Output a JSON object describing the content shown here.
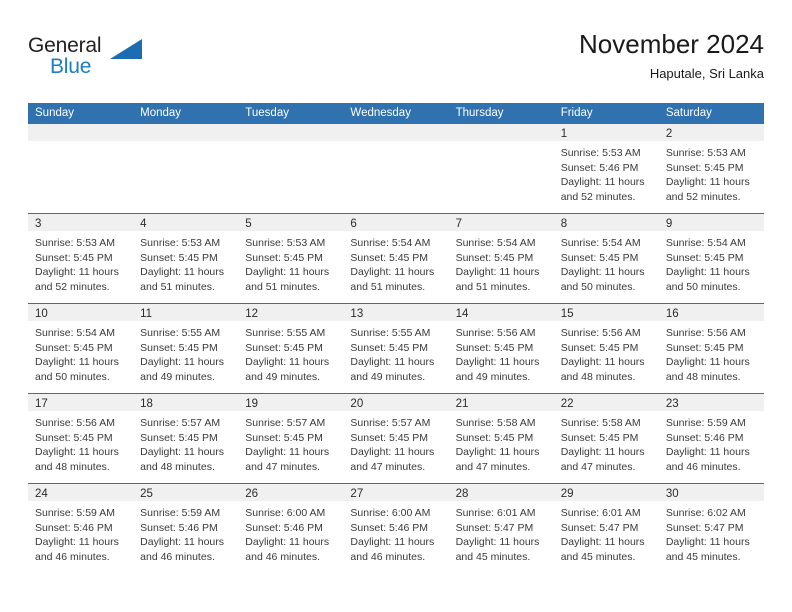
{
  "brand": {
    "word_one": "General",
    "word_two": "Blue",
    "logo_icon": "triangle-mark"
  },
  "header": {
    "month_title": "November 2024",
    "location": "Haputale, Sri Lanka"
  },
  "colors": {
    "header_blue": "#3071b0",
    "row_rule_blue": "#3071b0",
    "daynum_band": "#f0f0f0",
    "brand_blue": "#1b7fc4",
    "text": "#3a3a3a"
  },
  "calendar": {
    "weekday_headers": [
      "Sunday",
      "Monday",
      "Tuesday",
      "Wednesday",
      "Thursday",
      "Friday",
      "Saturday"
    ],
    "weeks": [
      [
        {
          "day": "",
          "lines": []
        },
        {
          "day": "",
          "lines": []
        },
        {
          "day": "",
          "lines": []
        },
        {
          "day": "",
          "lines": []
        },
        {
          "day": "",
          "lines": []
        },
        {
          "day": "1",
          "lines": [
            "Sunrise: 5:53 AM",
            "Sunset: 5:46 PM",
            "Daylight: 11 hours",
            "and 52 minutes."
          ]
        },
        {
          "day": "2",
          "lines": [
            "Sunrise: 5:53 AM",
            "Sunset: 5:45 PM",
            "Daylight: 11 hours",
            "and 52 minutes."
          ]
        }
      ],
      [
        {
          "day": "3",
          "lines": [
            "Sunrise: 5:53 AM",
            "Sunset: 5:45 PM",
            "Daylight: 11 hours",
            "and 52 minutes."
          ]
        },
        {
          "day": "4",
          "lines": [
            "Sunrise: 5:53 AM",
            "Sunset: 5:45 PM",
            "Daylight: 11 hours",
            "and 51 minutes."
          ]
        },
        {
          "day": "5",
          "lines": [
            "Sunrise: 5:53 AM",
            "Sunset: 5:45 PM",
            "Daylight: 11 hours",
            "and 51 minutes."
          ]
        },
        {
          "day": "6",
          "lines": [
            "Sunrise: 5:54 AM",
            "Sunset: 5:45 PM",
            "Daylight: 11 hours",
            "and 51 minutes."
          ]
        },
        {
          "day": "7",
          "lines": [
            "Sunrise: 5:54 AM",
            "Sunset: 5:45 PM",
            "Daylight: 11 hours",
            "and 51 minutes."
          ]
        },
        {
          "day": "8",
          "lines": [
            "Sunrise: 5:54 AM",
            "Sunset: 5:45 PM",
            "Daylight: 11 hours",
            "and 50 minutes."
          ]
        },
        {
          "day": "9",
          "lines": [
            "Sunrise: 5:54 AM",
            "Sunset: 5:45 PM",
            "Daylight: 11 hours",
            "and 50 minutes."
          ]
        }
      ],
      [
        {
          "day": "10",
          "lines": [
            "Sunrise: 5:54 AM",
            "Sunset: 5:45 PM",
            "Daylight: 11 hours",
            "and 50 minutes."
          ]
        },
        {
          "day": "11",
          "lines": [
            "Sunrise: 5:55 AM",
            "Sunset: 5:45 PM",
            "Daylight: 11 hours",
            "and 49 minutes."
          ]
        },
        {
          "day": "12",
          "lines": [
            "Sunrise: 5:55 AM",
            "Sunset: 5:45 PM",
            "Daylight: 11 hours",
            "and 49 minutes."
          ]
        },
        {
          "day": "13",
          "lines": [
            "Sunrise: 5:55 AM",
            "Sunset: 5:45 PM",
            "Daylight: 11 hours",
            "and 49 minutes."
          ]
        },
        {
          "day": "14",
          "lines": [
            "Sunrise: 5:56 AM",
            "Sunset: 5:45 PM",
            "Daylight: 11 hours",
            "and 49 minutes."
          ]
        },
        {
          "day": "15",
          "lines": [
            "Sunrise: 5:56 AM",
            "Sunset: 5:45 PM",
            "Daylight: 11 hours",
            "and 48 minutes."
          ]
        },
        {
          "day": "16",
          "lines": [
            "Sunrise: 5:56 AM",
            "Sunset: 5:45 PM",
            "Daylight: 11 hours",
            "and 48 minutes."
          ]
        }
      ],
      [
        {
          "day": "17",
          "lines": [
            "Sunrise: 5:56 AM",
            "Sunset: 5:45 PM",
            "Daylight: 11 hours",
            "and 48 minutes."
          ]
        },
        {
          "day": "18",
          "lines": [
            "Sunrise: 5:57 AM",
            "Sunset: 5:45 PM",
            "Daylight: 11 hours",
            "and 48 minutes."
          ]
        },
        {
          "day": "19",
          "lines": [
            "Sunrise: 5:57 AM",
            "Sunset: 5:45 PM",
            "Daylight: 11 hours",
            "and 47 minutes."
          ]
        },
        {
          "day": "20",
          "lines": [
            "Sunrise: 5:57 AM",
            "Sunset: 5:45 PM",
            "Daylight: 11 hours",
            "and 47 minutes."
          ]
        },
        {
          "day": "21",
          "lines": [
            "Sunrise: 5:58 AM",
            "Sunset: 5:45 PM",
            "Daylight: 11 hours",
            "and 47 minutes."
          ]
        },
        {
          "day": "22",
          "lines": [
            "Sunrise: 5:58 AM",
            "Sunset: 5:45 PM",
            "Daylight: 11 hours",
            "and 47 minutes."
          ]
        },
        {
          "day": "23",
          "lines": [
            "Sunrise: 5:59 AM",
            "Sunset: 5:46 PM",
            "Daylight: 11 hours",
            "and 46 minutes."
          ]
        }
      ],
      [
        {
          "day": "24",
          "lines": [
            "Sunrise: 5:59 AM",
            "Sunset: 5:46 PM",
            "Daylight: 11 hours",
            "and 46 minutes."
          ]
        },
        {
          "day": "25",
          "lines": [
            "Sunrise: 5:59 AM",
            "Sunset: 5:46 PM",
            "Daylight: 11 hours",
            "and 46 minutes."
          ]
        },
        {
          "day": "26",
          "lines": [
            "Sunrise: 6:00 AM",
            "Sunset: 5:46 PM",
            "Daylight: 11 hours",
            "and 46 minutes."
          ]
        },
        {
          "day": "27",
          "lines": [
            "Sunrise: 6:00 AM",
            "Sunset: 5:46 PM",
            "Daylight: 11 hours",
            "and 46 minutes."
          ]
        },
        {
          "day": "28",
          "lines": [
            "Sunrise: 6:01 AM",
            "Sunset: 5:47 PM",
            "Daylight: 11 hours",
            "and 45 minutes."
          ]
        },
        {
          "day": "29",
          "lines": [
            "Sunrise: 6:01 AM",
            "Sunset: 5:47 PM",
            "Daylight: 11 hours",
            "and 45 minutes."
          ]
        },
        {
          "day": "30",
          "lines": [
            "Sunrise: 6:02 AM",
            "Sunset: 5:47 PM",
            "Daylight: 11 hours",
            "and 45 minutes."
          ]
        }
      ]
    ]
  }
}
